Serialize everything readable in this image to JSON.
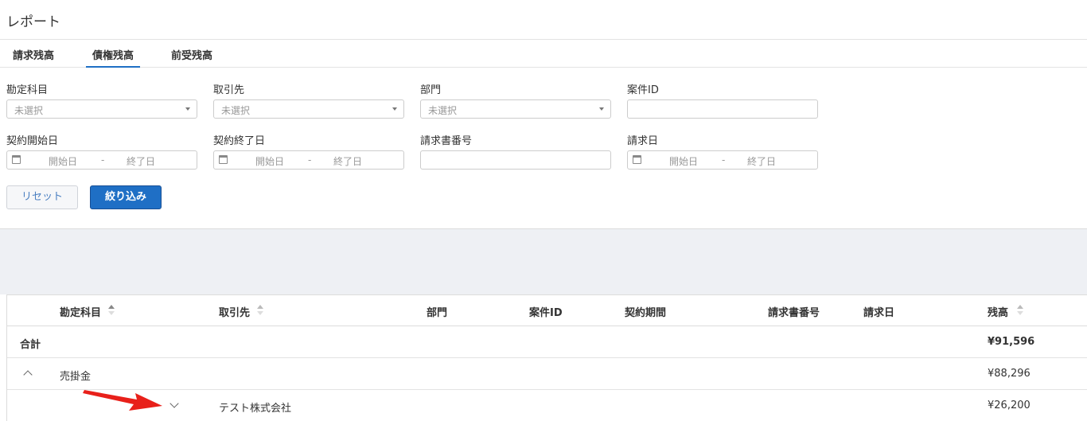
{
  "header": {
    "title": "レポート"
  },
  "tabs": [
    {
      "label": "請求残高",
      "active": false
    },
    {
      "label": "債権残高",
      "active": true
    },
    {
      "label": "前受残高",
      "active": false
    }
  ],
  "filters": {
    "account": {
      "label": "勘定科目",
      "placeholder": "未選択"
    },
    "partner": {
      "label": "取引先",
      "placeholder": "未選択"
    },
    "department": {
      "label": "部門",
      "placeholder": "未選択"
    },
    "project_id": {
      "label": "案件ID",
      "value": ""
    },
    "contract_start": {
      "label": "契約開始日",
      "start_placeholder": "開始日",
      "separator": "-",
      "end_placeholder": "終了日"
    },
    "contract_end": {
      "label": "契約終了日",
      "start_placeholder": "開始日",
      "separator": "-",
      "end_placeholder": "終了日"
    },
    "invoice_number": {
      "label": "請求書番号",
      "value": ""
    },
    "invoice_date": {
      "label": "請求日",
      "start_placeholder": "開始日",
      "separator": "-",
      "end_placeholder": "終了日"
    },
    "reset_label": "リセット",
    "filter_label": "絞り込み"
  },
  "table": {
    "columns": {
      "account": "勘定科目",
      "partner": "取引先",
      "department": "部門",
      "project_id": "案件ID",
      "contract_period": "契約期間",
      "invoice_number": "請求書番号",
      "invoice_date": "請求日",
      "balance": "残高"
    },
    "total": {
      "label": "合計",
      "balance": "¥91,596"
    },
    "group": {
      "account": "売掛金",
      "balance": "¥88,296",
      "expanded": true
    },
    "sub_row": {
      "partner": "テスト株式会社",
      "balance": "¥26,200",
      "expanded": false
    }
  },
  "colors": {
    "accent": "#1f6fc5",
    "annotation_arrow": "#e8201a",
    "background_gap": "#eef0f4"
  }
}
